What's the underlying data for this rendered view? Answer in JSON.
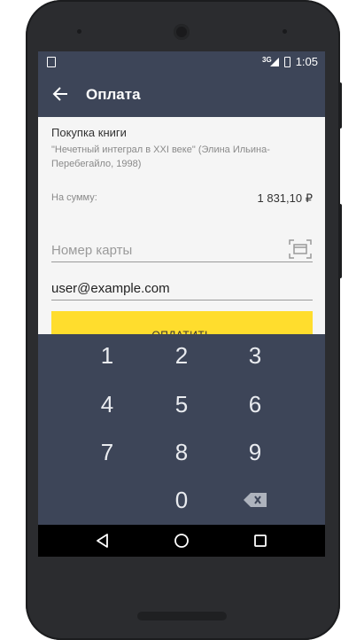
{
  "status_bar": {
    "network_type": "3G",
    "time": "1:05"
  },
  "app_bar": {
    "title": "Оплата",
    "back_icon": "arrow-back-icon"
  },
  "purchase": {
    "title": "Покупка книги",
    "description": "\"Нечетный интеграл в XXI веке\" (Элина Ильина-Перебегайло, 1998)",
    "amount_label": "На сумму:",
    "amount_value": "1 831,10 ₽"
  },
  "form": {
    "card_number_placeholder": "Номер карты",
    "card_scan_icon": "card-scan-icon",
    "email_value": "user@example.com",
    "pay_label": "ОПЛАТИТЬ"
  },
  "keypad": {
    "keys": [
      "1",
      "2",
      "3",
      "4",
      "5",
      "6",
      "7",
      "8",
      "9",
      "0"
    ],
    "backspace_icon": "backspace-icon"
  },
  "nav_bar": {
    "back": "nav-back-icon",
    "home": "nav-home-icon",
    "recents": "nav-recents-icon"
  },
  "colors": {
    "header": "#3d4558",
    "accent_button": "#ffdd2d",
    "keypad": "#3d4558"
  }
}
